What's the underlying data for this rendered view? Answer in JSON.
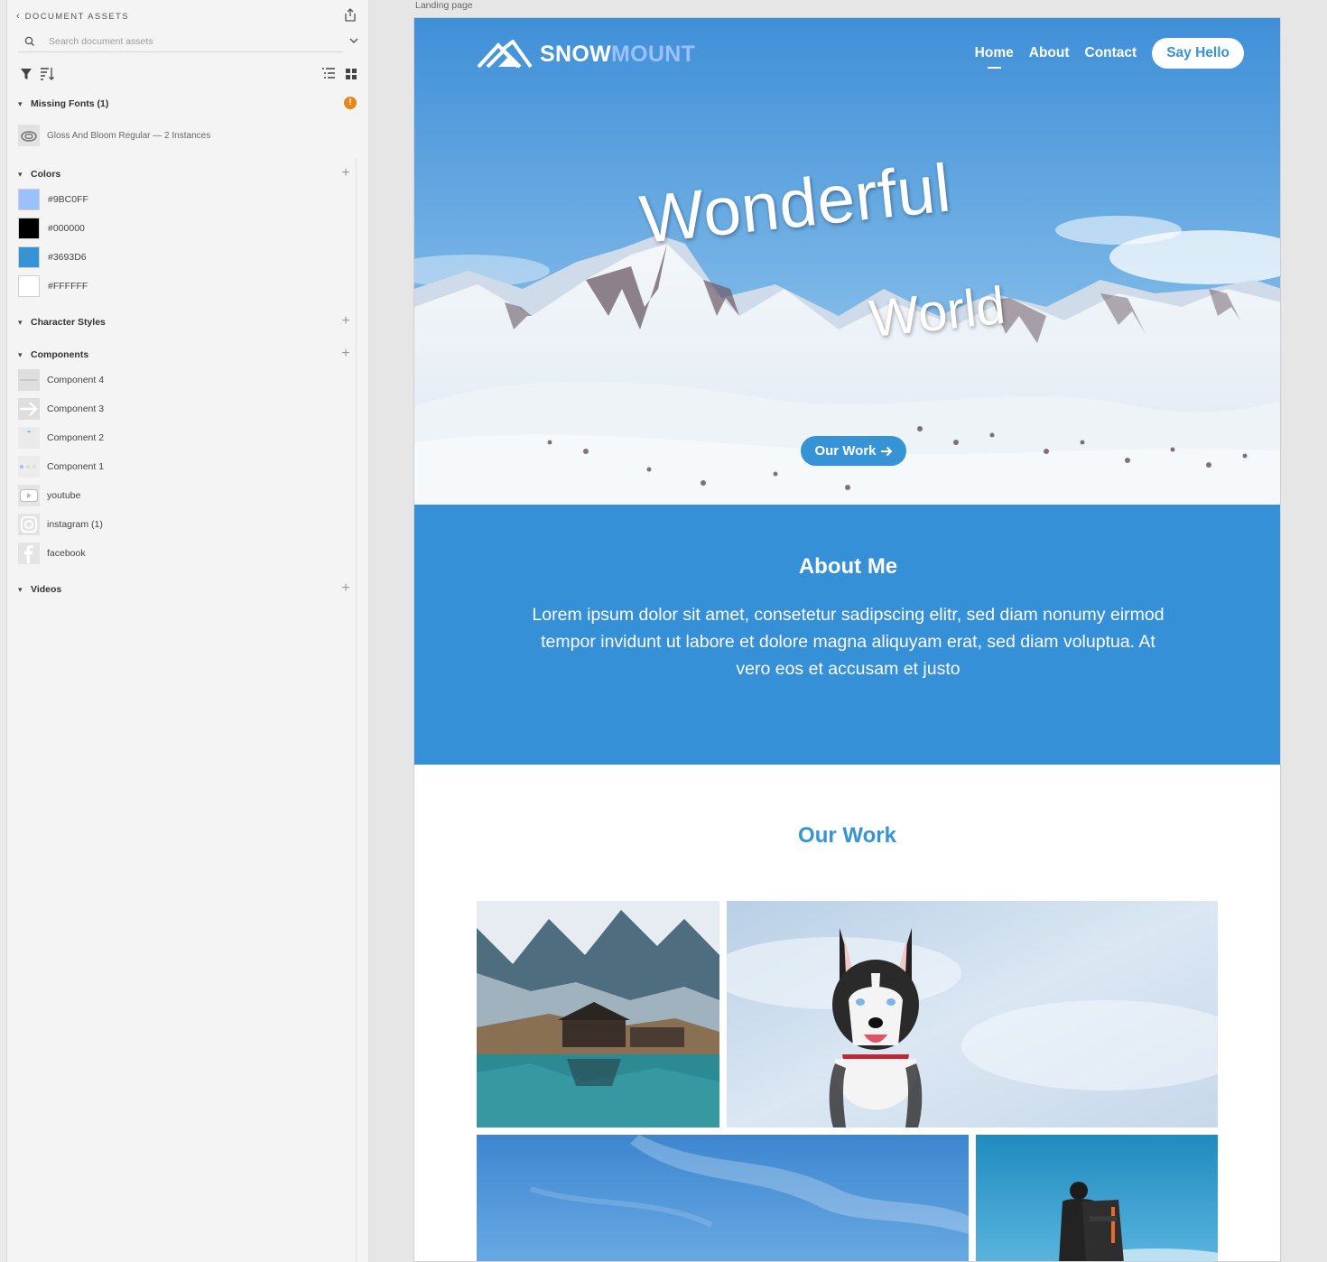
{
  "panel": {
    "header": "DOCUMENT ASSETS",
    "search_placeholder": "Search document assets",
    "missing_fonts": {
      "title": "Missing Fonts (1)",
      "items": [
        "Gloss And Bloom Regular — 2 Instances"
      ]
    },
    "colors": {
      "title": "Colors",
      "items": [
        {
          "label": "#9BC0FF",
          "hex": "#9bc0ff"
        },
        {
          "label": "#000000",
          "hex": "#000000"
        },
        {
          "label": "#3693D6",
          "hex": "#3693d6"
        },
        {
          "label": "#FFFFFF",
          "hex": "#ffffff"
        }
      ]
    },
    "character_styles": {
      "title": "Character Styles"
    },
    "components": {
      "title": "Components",
      "items": [
        {
          "label": "Component 4",
          "icon": "dash-icon"
        },
        {
          "label": "Component 3",
          "icon": "arrow-right-icon"
        },
        {
          "label": "Component 2",
          "icon": "quote-icon"
        },
        {
          "label": "Component 1",
          "icon": "dots-icon"
        },
        {
          "label": "youtube",
          "icon": "youtube-icon"
        },
        {
          "label": "instagram (1)",
          "icon": "instagram-icon"
        },
        {
          "label": "facebook",
          "icon": "facebook-icon"
        }
      ]
    },
    "videos": {
      "title": "Videos"
    }
  },
  "canvas": {
    "artboard_label": "Landing page",
    "logo_part1": "SNOW",
    "logo_part2": "MOUNT",
    "nav": [
      "Home",
      "About",
      "Contact"
    ],
    "cta": "Say Hello",
    "headline1": "Wonderful",
    "headline2": "World",
    "hero_button": "Our Work",
    "about_title": "About Me",
    "about_text": "Lorem ipsum dolor sit amet, consetetur sadipscing elitr, sed diam nonumy eirmod tempor invidunt ut labore et dolore magna aliquyam erat, sed diam voluptua. At vero eos et accusam et justo",
    "work_title": "Our Work"
  },
  "colors": {
    "accent": "#3693d6",
    "light_accent": "#9bc0ff",
    "warning": "#e68619"
  }
}
